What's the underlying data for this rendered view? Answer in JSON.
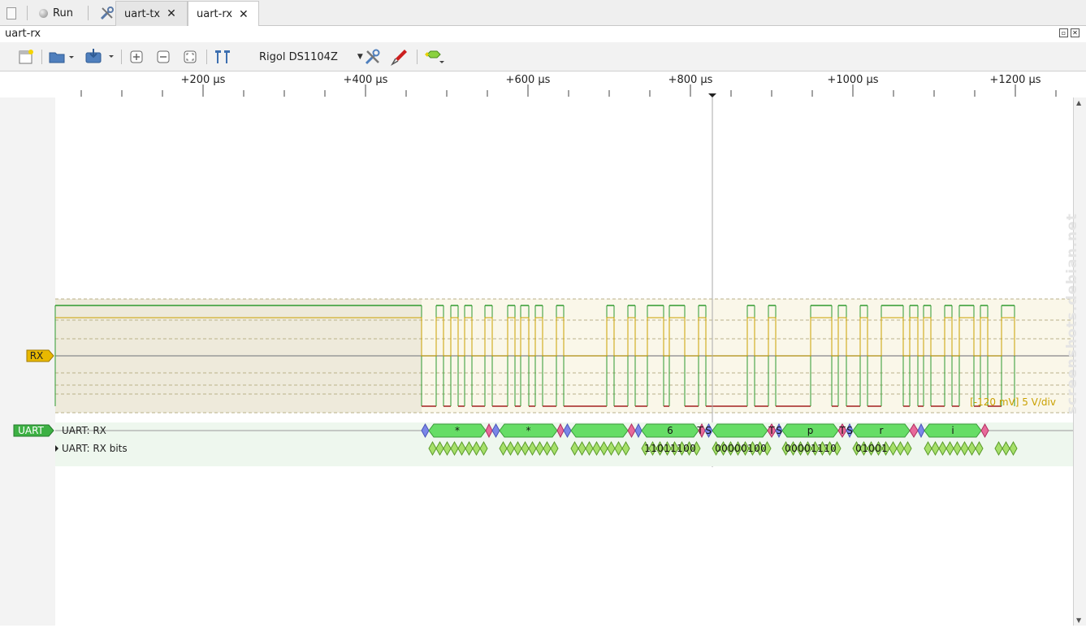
{
  "tabbar": {
    "run_label": "Run",
    "tabs": [
      {
        "label": "uart-tx",
        "active": false
      },
      {
        "label": "uart-rx",
        "active": true
      }
    ]
  },
  "window": {
    "title": "uart-rx"
  },
  "toolbar": {
    "device_label": "Rigol DS1104Z",
    "icons": [
      "new-session-icon",
      "open-icon",
      "save-icon",
      "zoom-in-icon",
      "zoom-out-icon",
      "zoom-fit-icon",
      "cursor-icon",
      "device-settings-icon",
      "probe-icon",
      "decoder-icon"
    ]
  },
  "ruler": {
    "ticks": [
      "+200 µs",
      "+400 µs",
      "+600 µs",
      "+800 µs",
      "+1000 µs",
      "+1200 µs"
    ]
  },
  "analog": {
    "channel_label": "RX",
    "scale_label": "[-120 mV] 5 V/div",
    "channel_color": "#d4a300"
  },
  "decoder": {
    "badge": "UART",
    "badge_color": "#3cb043",
    "row1_label": "UART: RX",
    "row2_label": "UART: RX bits",
    "bytes": [
      "*",
      "*",
      "",
      "6",
      "",
      "p",
      "r",
      "i"
    ],
    "bits": [
      "",
      "",
      "",
      "11011100",
      "00000100",
      "00001110",
      "01001",
      "",
      ""
    ],
    "stop_labels": [
      "T",
      "S",
      "T",
      "S",
      "T",
      "S"
    ]
  },
  "watermark": "screenshots.debian.net",
  "colors": {
    "data_annotation": "#66dd66",
    "start_bit": "#7a86e8",
    "stop_bit": "#e86a9a",
    "bit_annotation": "#a6e06a"
  }
}
